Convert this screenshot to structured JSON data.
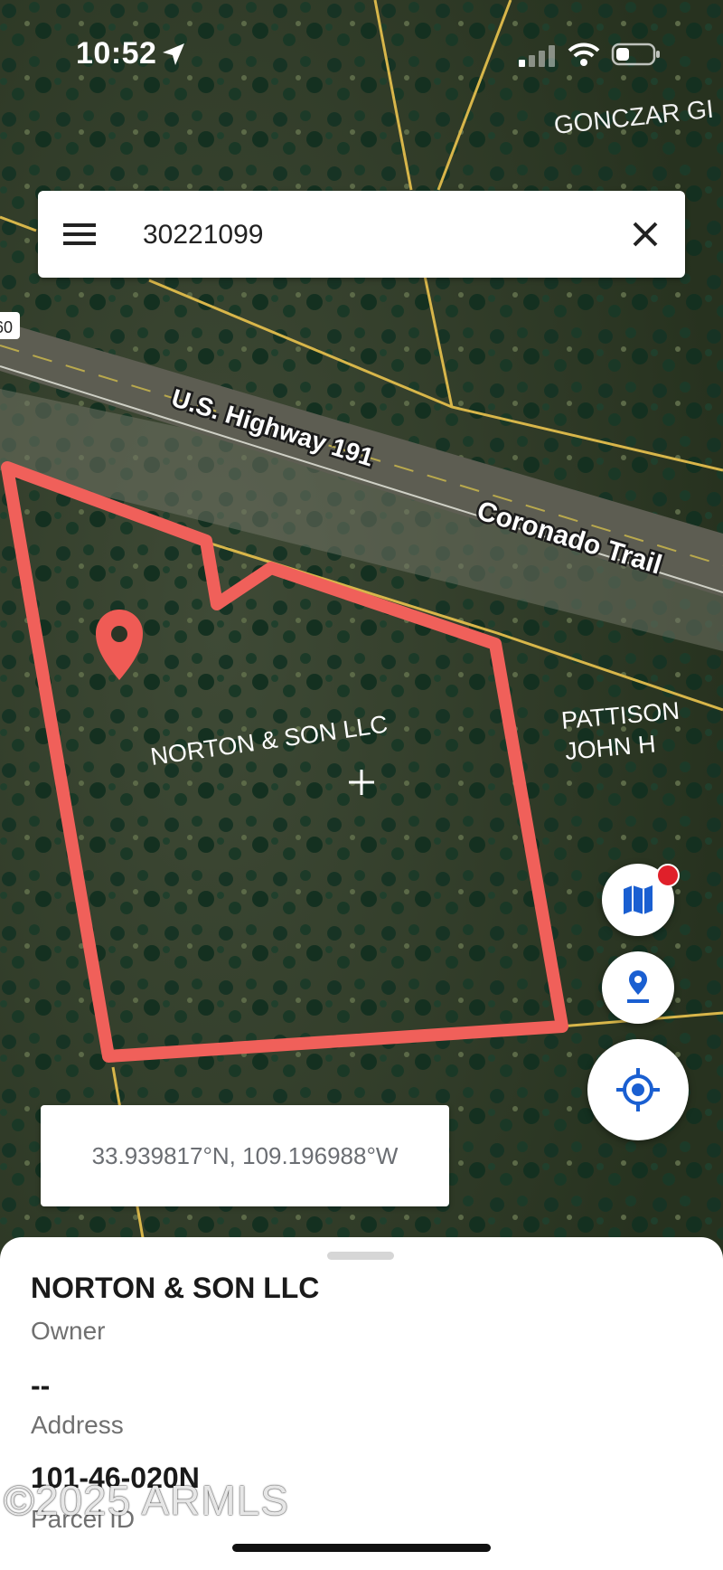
{
  "status_bar": {
    "time": "10:52"
  },
  "search": {
    "query": "30221099",
    "placeholder": ""
  },
  "map_labels": {
    "gonczar": "GONCZAR GI",
    "highway_number": "U.S. Highway 191",
    "highway_name": "Coronado Trail",
    "parcel_owner": "NORTON & SON LLC",
    "neighbor_line1": "PATTISON",
    "neighbor_line2": "JOHN H",
    "route_shield": "60"
  },
  "coordinates": "33.939817°N, 109.196988°W",
  "parcel": {
    "owner_value": "NORTON & SON LLC",
    "owner_label": "Owner",
    "address_value": "--",
    "address_label": "Address",
    "parcel_id_value": "101-46-020N",
    "parcel_id_label": "Parcel ID"
  },
  "watermark": "©2025 ARMLS",
  "colors": {
    "parcel_outline": "#f0605a",
    "accent_blue": "#1a5fd1",
    "marker": "#ef5b55",
    "notification_dot": "#e0202a"
  },
  "icons": [
    "location-arrow-icon",
    "signal-icon",
    "wifi-icon",
    "battery-icon",
    "menu-icon",
    "close-icon",
    "map-layers-icon",
    "drop-pin-icon",
    "my-location-icon",
    "map-marker-icon",
    "crosshair-icon"
  ]
}
